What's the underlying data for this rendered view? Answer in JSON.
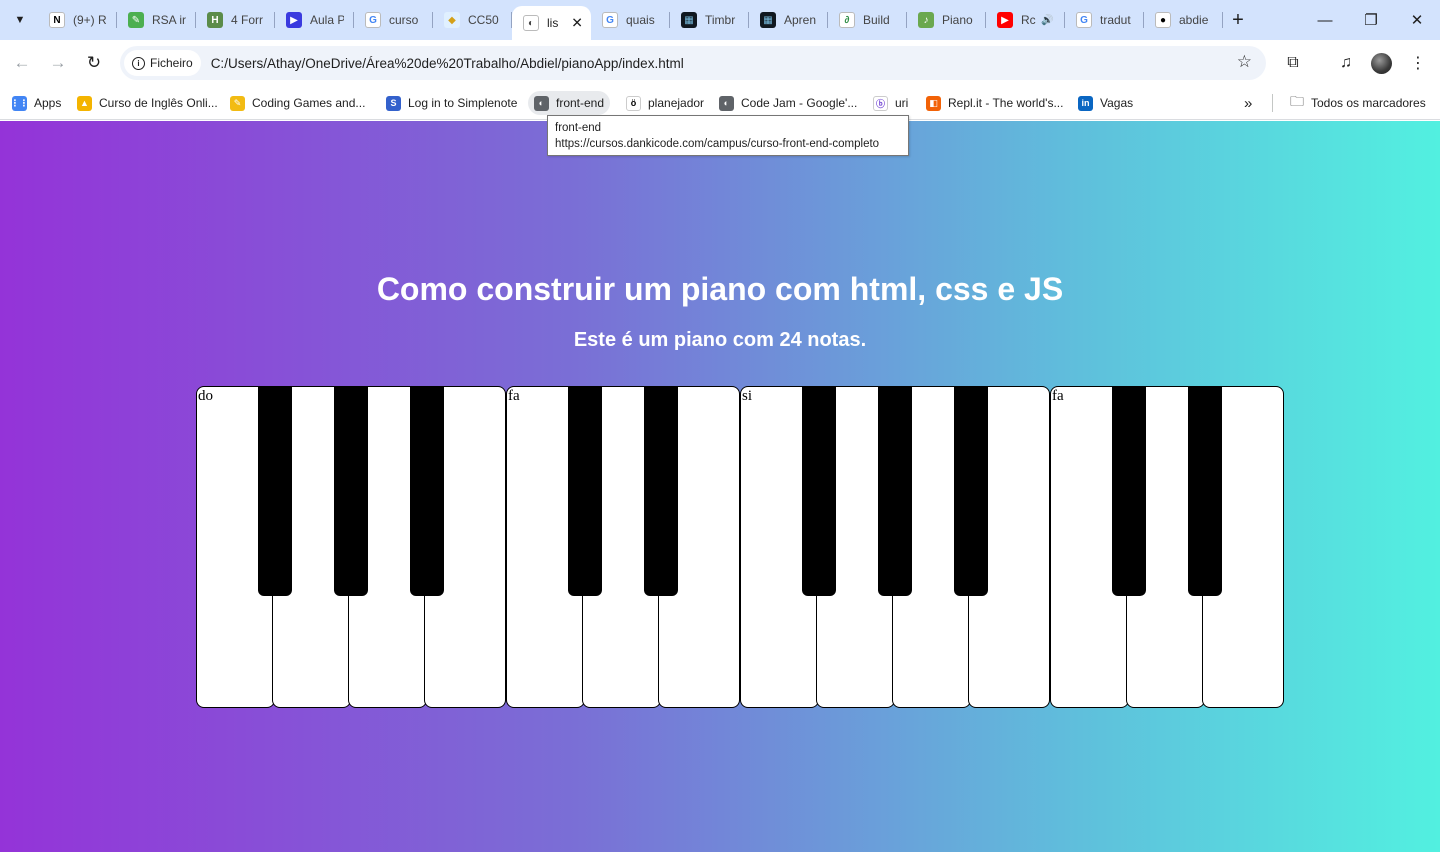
{
  "browser": {
    "tabs": [
      {
        "label": "(9+) R",
        "icon": "notion-icon",
        "color": "#ffffff",
        "glyph": "N",
        "fg": "#000"
      },
      {
        "label": "RSA ir",
        "icon": "leaf-icon",
        "color": "#4caf50",
        "glyph": "✎",
        "fg": "#fff"
      },
      {
        "label": "4 Forr",
        "icon": "badge-icon",
        "color": "#5b8c4a",
        "glyph": "H",
        "fg": "#fff"
      },
      {
        "label": "Aula P",
        "icon": "video-icon",
        "color": "#3a3adf",
        "glyph": "▶",
        "fg": "#fff"
      },
      {
        "label": "curso",
        "icon": "google-icon",
        "color": "#ffffff",
        "glyph": "G",
        "fg": "#4285f4"
      },
      {
        "label": "CC50",
        "icon": "cc50-icon",
        "color": "#e0f0ff",
        "glyph": "◆",
        "fg": "#d4a017"
      },
      {
        "label": "lis",
        "icon": "globe-icon",
        "color": "#ffffff",
        "glyph": "◐",
        "fg": "#444",
        "active": true
      },
      {
        "label": "quais",
        "icon": "google-icon",
        "color": "#ffffff",
        "glyph": "G",
        "fg": "#4285f4"
      },
      {
        "label": "Timbr",
        "icon": "timbre-icon",
        "color": "#101820",
        "glyph": "▦",
        "fg": "#7bd"
      },
      {
        "label": "Apren",
        "icon": "timbre-icon",
        "color": "#101820",
        "glyph": "▦",
        "fg": "#7bd"
      },
      {
        "label": "Build",
        "icon": "gfg-icon",
        "color": "#ffffff",
        "glyph": "∂",
        "fg": "#2f8d46"
      },
      {
        "label": "Piano",
        "icon": "music-icon",
        "color": "#6aa84f",
        "glyph": "♪",
        "fg": "#fff"
      },
      {
        "label": "Rc",
        "icon": "youtube-icon",
        "color": "#ff0000",
        "glyph": "▶",
        "fg": "#fff",
        "audio": true
      },
      {
        "label": "tradut",
        "icon": "google-icon",
        "color": "#ffffff",
        "glyph": "G",
        "fg": "#4285f4"
      },
      {
        "label": "abdie",
        "icon": "github-icon",
        "color": "#ffffff",
        "glyph": "●",
        "fg": "#000"
      }
    ],
    "close_tab": "✕",
    "new_tab": "+",
    "window": {
      "minimize": "—",
      "restore": "❐",
      "close": "✕"
    },
    "omnibox": {
      "chip_label": "Ficheiro",
      "url": "C:/Users/Athay/OneDrive/Área%20de%20Trabalho/Abdiel/pianoApp/index.html"
    },
    "bookmarks": [
      {
        "label": "Apps",
        "icon": "apps-grid-icon",
        "color": "#4285f4",
        "glyph": "⋮⋮"
      },
      {
        "label": "Curso de Inglês Onli...",
        "icon": "graduation-cap-icon",
        "color": "#f4b400",
        "glyph": "▲"
      },
      {
        "label": "Coding Games and...",
        "icon": "codingame-icon",
        "color": "#f2bb13",
        "glyph": "✎"
      },
      {
        "label": "Log in to Simplenote",
        "icon": "simplenote-icon",
        "color": "#3361cc",
        "glyph": "S"
      },
      {
        "label": "front-end",
        "icon": "globe-icon",
        "color": "#5f6368",
        "glyph": "◐",
        "hover": true
      },
      {
        "label": "planejador",
        "icon": "notion-icon",
        "color": "#ffffff",
        "glyph": "ö",
        "fg": "#000"
      },
      {
        "label": "Code Jam - Google'...",
        "icon": "globe-icon",
        "color": "#5f6368",
        "glyph": "◐"
      },
      {
        "label": "uri",
        "icon": "beecrowd-icon",
        "color": "#ffffff",
        "glyph": "ⓑ",
        "fg": "#7a4fd6"
      },
      {
        "label": "Repl.it - The world's...",
        "icon": "replit-icon",
        "color": "#f26207",
        "glyph": "◧"
      },
      {
        "label": "Vagas",
        "icon": "linkedin-icon",
        "color": "#0a66c2",
        "glyph": "in"
      }
    ],
    "more_bookmarks": "»",
    "all_bookmarks": "Todos os marcadores",
    "tooltip": {
      "title": "front-end",
      "url": "https://cursos.dankicode.com/campus/curso-front-end-completo"
    }
  },
  "page": {
    "title": "Como construir um piano com html, css e JS",
    "subtitle": "Este é um piano com 24 notas.",
    "gradient": [
      "#9433d8",
      "#52f0e0"
    ],
    "piano": {
      "white_key_labels": [
        "do",
        "",
        "",
        "",
        "fa",
        "",
        "",
        "si",
        "",
        "",
        "",
        "fa",
        "",
        ""
      ],
      "groups": [
        [
          0,
          4
        ],
        [
          4,
          7
        ],
        [
          7,
          11
        ],
        [
          11,
          14
        ]
      ]
    }
  }
}
